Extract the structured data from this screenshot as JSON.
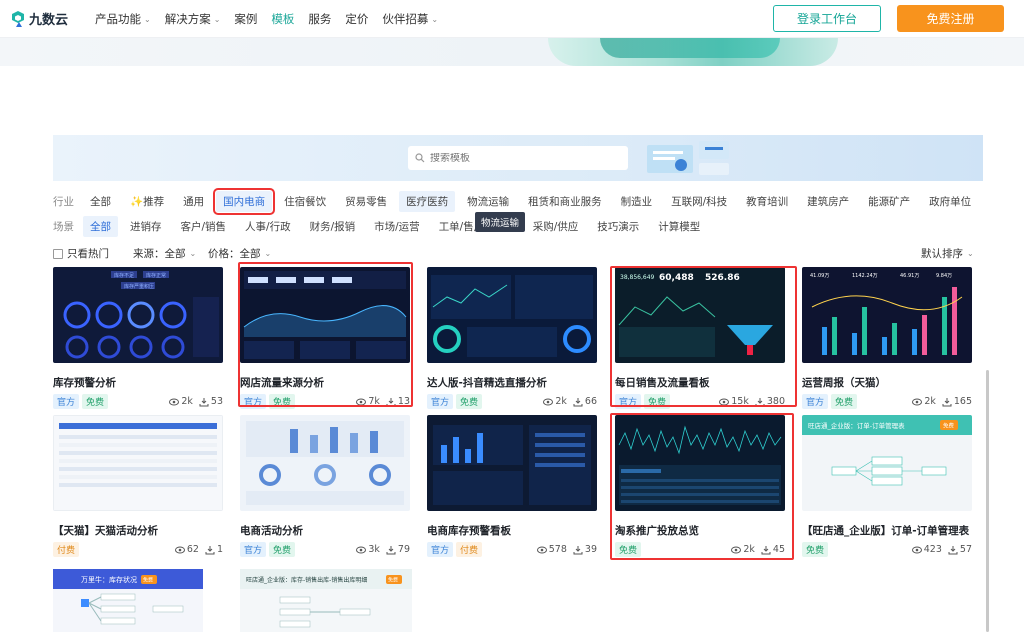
{
  "brand": {
    "name": "九数云"
  },
  "nav": {
    "items": [
      {
        "label": "产品功能",
        "chevron": true
      },
      {
        "label": "解决方案",
        "chevron": true
      },
      {
        "label": "案例",
        "chevron": false
      },
      {
        "label": "模板",
        "chevron": false,
        "active": true
      },
      {
        "label": "服务",
        "chevron": false
      },
      {
        "label": "定价",
        "chevron": false
      },
      {
        "label": "伙伴招募",
        "chevron": true
      }
    ],
    "login": "登录工作台",
    "register": "免费注册"
  },
  "search": {
    "placeholder": "搜索模板"
  },
  "industry": {
    "label": "行业",
    "chips": [
      "全部",
      "✨推荐",
      "通用",
      "国内电商",
      "住宿餐饮",
      "贸易零售",
      "医疗医药",
      "物流运输",
      "租赁和商业服务",
      "制造业",
      "互联网/科技",
      "教育培训",
      "建筑房产",
      "能源矿产",
      "政府单位"
    ]
  },
  "scene": {
    "label": "场景",
    "chips": [
      "全部",
      "进销存",
      "客户/销售",
      "人事/行政",
      "财务/报销",
      "市场/运营",
      "工单/售后",
      "产",
      "采购/供应",
      "技巧演示",
      "计算模型"
    ]
  },
  "tooltip": "物流运输",
  "options": {
    "hot_only": "只看热门",
    "source": "来源：全部",
    "price": "价格：全部",
    "sort": "默认排序"
  },
  "cards": [
    {
      "title": "库存预警分析",
      "tags": [
        "官方",
        "免费"
      ],
      "views": "2k",
      "downloads": "53"
    },
    {
      "title": "网店流量来源分析",
      "tags": [
        "官方",
        "免费"
      ],
      "views": "7k",
      "downloads": "13"
    },
    {
      "title": "达人版-抖音精选直播分析",
      "tags": [
        "官方",
        "免费"
      ],
      "views": "2k",
      "downloads": "66"
    },
    {
      "title": "每日销售及流量看板",
      "tags": [
        "官方",
        "免费"
      ],
      "views": "15k",
      "downloads": "380"
    },
    {
      "title": "运营周报（天猫）",
      "tags": [
        "官方",
        "免费"
      ],
      "views": "2k",
      "downloads": "165"
    },
    {
      "title": "【天猫】天猫活动分析",
      "tags": [
        "付费"
      ],
      "views": "62",
      "downloads": "1"
    },
    {
      "title": "电商活动分析",
      "tags": [
        "官方",
        "免费"
      ],
      "views": "3k",
      "downloads": "79"
    },
    {
      "title": "电商库存预警看板",
      "tags": [
        "官方",
        "付费"
      ],
      "views": "578",
      "downloads": "39"
    },
    {
      "title": "淘系推广投放总览",
      "tags": [
        "免费"
      ],
      "views": "2k",
      "downloads": "45"
    },
    {
      "title": "【旺店通_企业版】订单-订单管理表",
      "tags": [
        "免费"
      ],
      "views": "423",
      "downloads": "57"
    }
  ],
  "thumb_text": {
    "card1": [
      "库存不足",
      "库存正常",
      "库存严重积压"
    ],
    "card4": [
      "38,856,649",
      "60,488",
      "526.86"
    ],
    "card5": [
      "41.09万",
      "1142.24万",
      "46.91万",
      "9.84万"
    ],
    "card10": [
      "旺店通_企业版：订单-订单管理表",
      "免费"
    ],
    "card11": [
      "万里牛：库存状况",
      "免费"
    ],
    "card12": [
      "旺店通_企业版：库存-销售出库-销售出库明细",
      "免费"
    ]
  }
}
